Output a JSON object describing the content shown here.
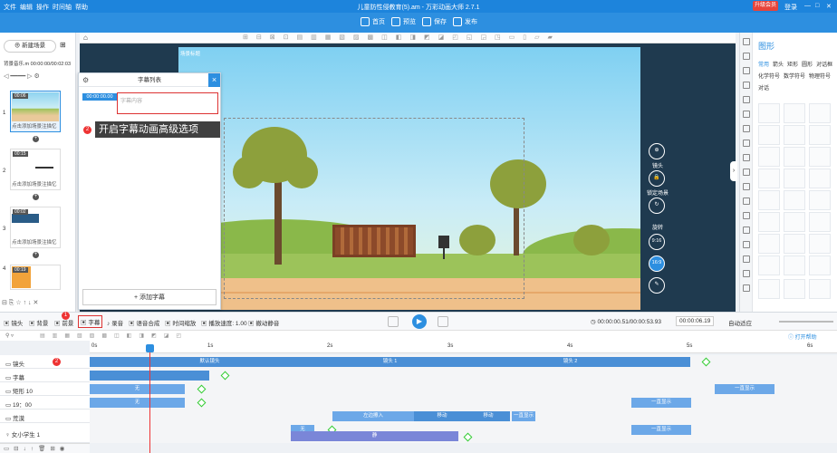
{
  "titlebar": {
    "menu": [
      "文件",
      "编辑",
      "操作",
      "时间轴",
      "帮助"
    ],
    "title": "儿童防性侵教育(5).am - 万彩动画大师 2.7.1",
    "upgrade": "升级会员",
    "login": "登录"
  },
  "toolbar": {
    "home": "首页",
    "preview": "预览",
    "save": "保存",
    "publish": "发布"
  },
  "left": {
    "new_scene": "新建场景",
    "bgm_label": "背景音乐.m",
    "bgm_time": "00:00:00/00:02:03",
    "slides": [
      {
        "num": "1",
        "time": "00:06",
        "caption": "点击添加场景注描忆"
      },
      {
        "num": "2",
        "time": "00:15",
        "caption": "点击添加场景注描忆"
      },
      {
        "num": "3",
        "time": "00:02",
        "caption": "点击添加场景注描忆"
      },
      {
        "num": "4",
        "time": "00:19",
        "caption": ""
      }
    ]
  },
  "canvas": {
    "scene_label": "场景标题"
  },
  "subtitle_panel": {
    "title": "字幕列表",
    "time": "00:00:00.00",
    "placeholder": "字幕内容",
    "add": "添加字幕",
    "close": "×"
  },
  "callout": {
    "badge": "2",
    "text": "开启字幕动画高级选项"
  },
  "overlay": {
    "lens": "镜头",
    "lock": "锁定场景",
    "rotate": "旋转",
    "r169": "16:9",
    "r916": "9:16"
  },
  "right_panel": {
    "title": "图形",
    "tabs_row1": [
      "常用",
      "箭头",
      "矩形",
      "圆形",
      "对话框"
    ],
    "tabs_row2": [
      "化学符号",
      "数学符号",
      "物理符号"
    ],
    "tabs_row3": [
      "对话"
    ]
  },
  "bottombar": {
    "items": [
      "镜头",
      "背景",
      "前景",
      "字幕",
      "录音",
      "语音合成",
      "时间缩放",
      "播放速度: 1.00",
      "撤动静音"
    ],
    "badge": "1",
    "time": "00:00:00.51/00:00:53.93",
    "step": "00:00:06.19",
    "auto": "自动适应"
  },
  "timeline": {
    "help": "打开帮助",
    "ruler": [
      "0s",
      "1s",
      "2s",
      "3s",
      "4s",
      "5s",
      "6s"
    ],
    "tracks": [
      {
        "label": "镜头",
        "badge": "2"
      },
      {
        "label": "字幕"
      },
      {
        "label": "矩形 10"
      },
      {
        "label": "19：00"
      },
      {
        "label": "荒漠"
      },
      {
        "label": "女小学生 1"
      }
    ],
    "clips": {
      "lens_default": "默认镜头",
      "lens1": "镜头 1",
      "lens2": "镜头 2",
      "none": "无",
      "appear": "一直显示",
      "move_in": "左边擦入",
      "move": "移动",
      "still": "静"
    }
  }
}
